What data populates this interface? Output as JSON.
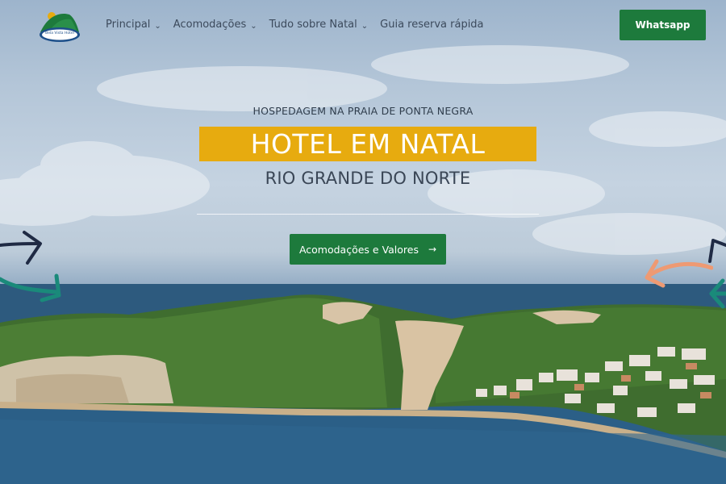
{
  "logo": {
    "text": "Bela Vista Hotel"
  },
  "nav": {
    "items": [
      {
        "label": "Principal",
        "dropdown": true
      },
      {
        "label": "Acomodações",
        "dropdown": true
      },
      {
        "label": "Tudo sobre Natal",
        "dropdown": true
      },
      {
        "label": "Guia reserva rápida",
        "dropdown": false
      }
    ],
    "dropdown_icon": "chevron-down-icon"
  },
  "whatsapp_button": {
    "label": "Whatsapp"
  },
  "hero": {
    "eyebrow": "HOSPEDAGEM NA PRAIA DE PONTA NEGRA",
    "title": "HOTEL EM NATAL",
    "subtitle": "RIO GRANDE DO NORTE",
    "cta_label": "Acomodações e Valores",
    "cta_icon": "arrow-right-icon"
  },
  "colors": {
    "accent_green": "#1d7a3c",
    "title_yellow": "#e7ab0f",
    "arrow_navy": "#1f2a44",
    "arrow_teal": "#1a8a7a",
    "arrow_salmon": "#ee9a73"
  }
}
